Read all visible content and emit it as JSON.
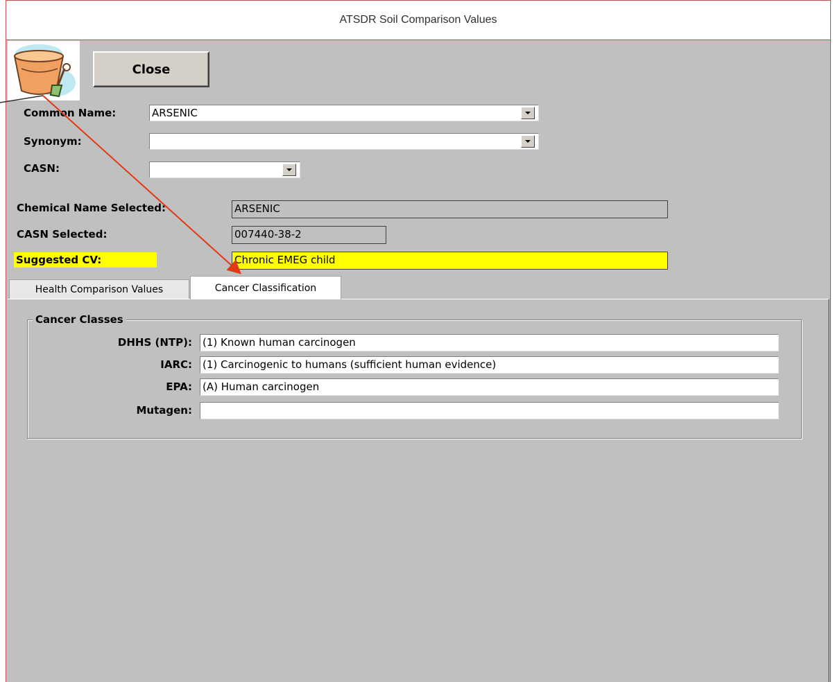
{
  "window": {
    "title": "ATSDR Soil Comparison Values"
  },
  "toolbar": {
    "close_label": "Close",
    "logo_icon": "bucket-and-shovel-icon"
  },
  "form": {
    "common_name_label": "Common Name:",
    "common_name_value": "ARSENIC",
    "synonym_label": "Synonym:",
    "synonym_value": "",
    "casn_label": "CASN:",
    "casn_value": "",
    "chemical_selected_label": "Chemical Name Selected:",
    "chemical_selected_value": "ARSENIC",
    "casn_selected_label": "CASN Selected:",
    "casn_selected_value": "007440-38-2",
    "suggested_cv_label": "Suggested CV:",
    "suggested_cv_value": "Chronic EMEG child"
  },
  "tabs": [
    {
      "label": "Health Comparison Values",
      "active": false
    },
    {
      "label": "Cancer Classification",
      "active": true
    }
  ],
  "cancer": {
    "group_title": "Cancer Classes",
    "rows": [
      {
        "label": "DHHS (NTP):",
        "value": "(1) Known human carcinogen"
      },
      {
        "label": "IARC:",
        "value": "(1) Carcinogenic to humans (sufficient human evidence)"
      },
      {
        "label": "EPA:",
        "value": "(A) Human carcinogen"
      },
      {
        "label": "Mutagen:",
        "value": ""
      }
    ]
  },
  "colors": {
    "highlight": "#ffff00",
    "annotation_arrow": "#e03a10",
    "window_border": "#c15050",
    "panel": "#c0c0c0"
  }
}
